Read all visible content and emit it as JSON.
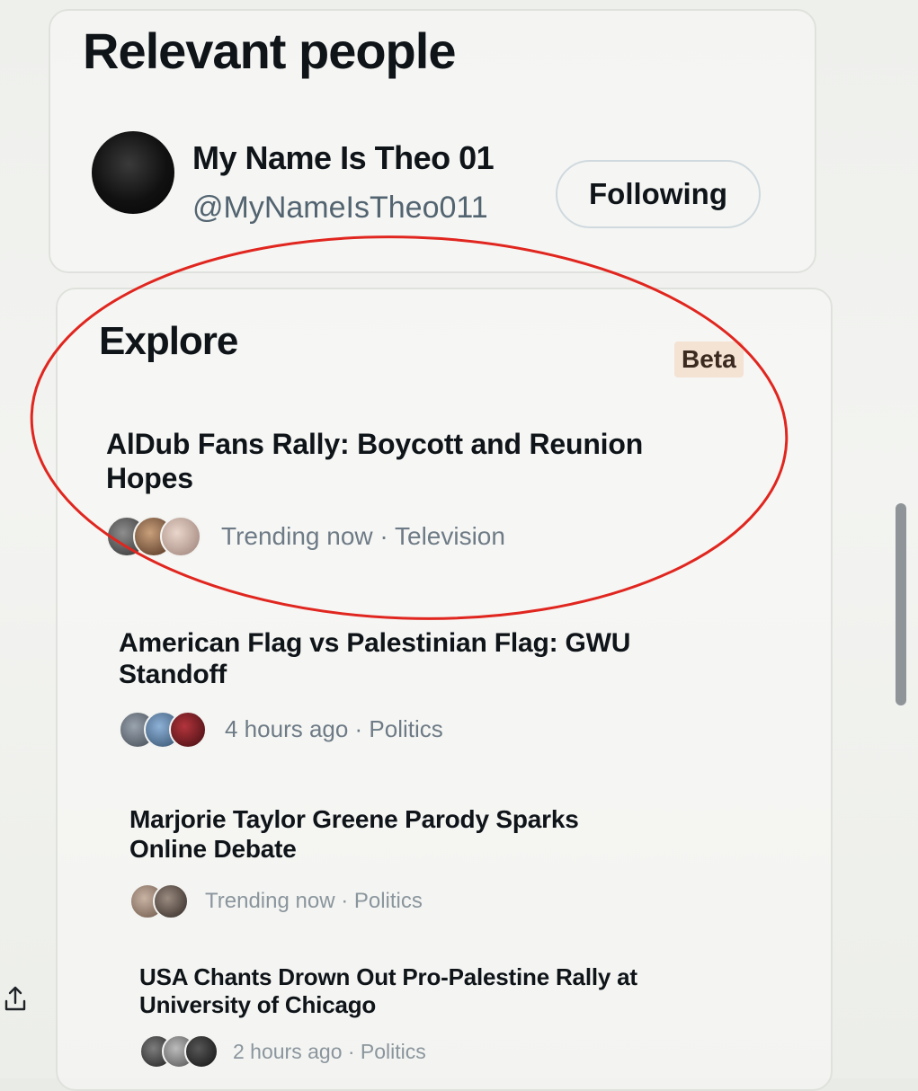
{
  "relevant_people": {
    "title": "Relevant people",
    "user": {
      "name": "My Name Is Theo 01",
      "handle": "@MyNameIsTheo011",
      "follow_label": "Following"
    }
  },
  "explore": {
    "title": "Explore",
    "badge": "Beta",
    "trends": [
      {
        "title": "AlDub Fans Rally: Boycott and Reunion Hopes",
        "meta": "Trending now · Television"
      },
      {
        "title": "American Flag vs Palestinian Flag: GWU Standoff",
        "meta": "4 hours ago · Politics"
      },
      {
        "title": "Marjorie Taylor Greene Parody Sparks Online Debate",
        "meta": "Trending now · Politics"
      },
      {
        "title": "USA Chants Drown Out Pro-Palestine Rally at University of Chicago",
        "meta": "2 hours ago · Politics"
      }
    ]
  },
  "colors": {
    "annotation": "#e0261f",
    "secondary_text": "#536471",
    "beta_badge_bg": "#f4e2d3"
  },
  "icons": {
    "share": "share-icon"
  }
}
